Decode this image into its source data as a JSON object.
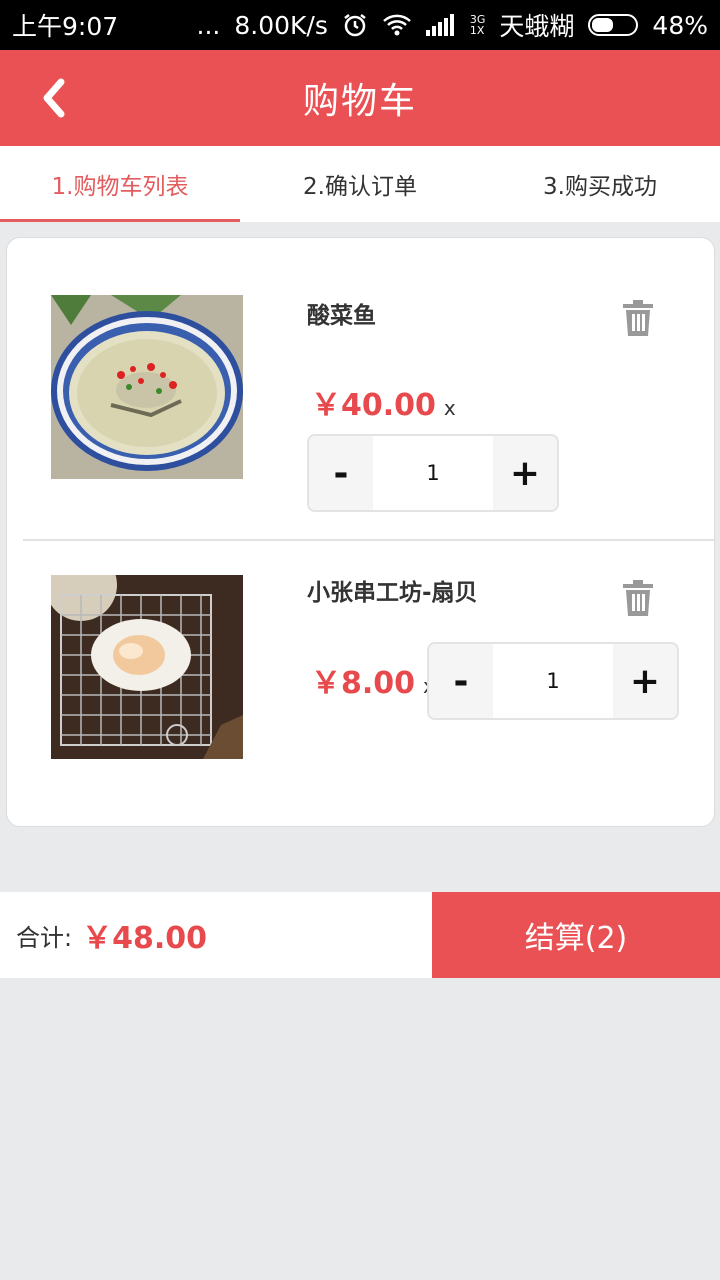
{
  "status_bar": {
    "time": "上午9:07",
    "dots": "...",
    "speed": "8.00K/s",
    "net_top": "3G",
    "net_bottom": "1X",
    "carrier": "天蛾糊",
    "battery": "48%",
    "battery_level": 0.48
  },
  "header": {
    "title": "购物车",
    "back_icon": "chevron-left-icon"
  },
  "tabs": [
    {
      "label": "1.购物车列表",
      "active": true
    },
    {
      "label": "2.确认订单",
      "active": false
    },
    {
      "label": "3.购买成功",
      "active": false
    }
  ],
  "cart": {
    "currency": "¥",
    "times_sign": "x",
    "minus_label": "-",
    "plus_label": "+",
    "items": [
      {
        "name": "酸菜鱼",
        "price": "￥40.00",
        "quantity": "1"
      },
      {
        "name": "小张串工坊-扇贝",
        "price": "￥8.00",
        "quantity": "1"
      }
    ]
  },
  "footer": {
    "total_label": "合计:",
    "total_value": "￥48.00",
    "checkout_label": "结算(2)"
  },
  "colors": {
    "accent": "#ea5154",
    "price": "#e8494c",
    "background": "#e9eaec"
  }
}
